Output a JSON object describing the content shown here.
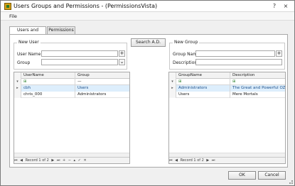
{
  "window": {
    "title": "Users Groups and Permissions - (PermissionsVista)",
    "help": "?",
    "close": "×"
  },
  "menu": {
    "file": "File"
  },
  "tabs": [
    {
      "label": "Users and Groups"
    },
    {
      "label": "Permissions"
    }
  ],
  "search_ad": "Search A.D.",
  "new_user": {
    "title": "New User",
    "username_label": "User Name",
    "group_label": "Group",
    "add": "+",
    "dropdown": "⌄"
  },
  "new_group": {
    "title": "New Group",
    "groupname_label": "Group Name",
    "description_label": "Description",
    "add": "+"
  },
  "users_grid": {
    "headers": [
      "UserName",
      "Group"
    ],
    "filter_icon": "filter-icon",
    "filter_value": "—",
    "rows": [
      {
        "indicator": "▸",
        "cells": [
          "cbh",
          "Users"
        ]
      },
      {
        "indicator": "",
        "cells": [
          "chris_000",
          "Administrators"
        ]
      }
    ],
    "nav": {
      "first": "⏮",
      "prev": "◀",
      "record": "Record 1 of 2",
      "next": "▶",
      "last": "⏭",
      "add": "+",
      "remove": "−",
      "edit": "▴",
      "save": "✓",
      "cancel": "✕"
    }
  },
  "groups_grid": {
    "headers": [
      "GroupName",
      "Description"
    ],
    "rows": [
      {
        "indicator": "▸",
        "cells": [
          "Administrators",
          "The Great and Powerful OZ"
        ]
      },
      {
        "indicator": "",
        "cells": [
          "Users",
          "Mere Mortals"
        ]
      }
    ],
    "nav": {
      "first": "⏮",
      "prev": "◀",
      "record": "Record 1 of 2",
      "next": "▶",
      "last": "⏭"
    }
  },
  "buttons": {
    "ok": "OK",
    "cancel": "Cancel"
  }
}
